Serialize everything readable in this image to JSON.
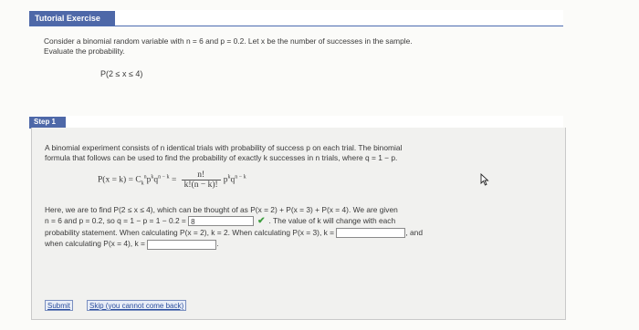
{
  "header": {
    "title": "Tutorial Exercise"
  },
  "problem": {
    "line1": "Consider a binomial random variable with n = 6 and p = 0.2. Let x be the number of successes in the sample.",
    "line2": "Evaluate the probability.",
    "expression": "P(2 ≤ x ≤ 4)"
  },
  "step": {
    "label": "Step 1",
    "intro_line1": "A binomial experiment consists of n identical trials with probability of success p on each trial. The binomial",
    "intro_line2": "formula that follows can be used to find the probability of exactly k successes in n trials, where q = 1 − p.",
    "formula_lhs": "P(x = k) = C",
    "formula_sub": "k",
    "formula_sup": "n",
    "formula_mid": "p",
    "formula_tail": "q",
    "formula_exp_k": "k",
    "formula_exp_nk": "n − k",
    "formula_eq": " = ",
    "frac_num": "n!",
    "frac_den": "k!(n − k)!",
    "body_line1": "Here, we are to find P(2 ≤ x ≤ 4), which can be thought of as P(x = 2) + P(x = 3) + P(x = 4). We are given",
    "body_line2_pre": "n = 6 and p = 0.2, so q = 1 − p = 1 − 0.2 =",
    "q_value": "8",
    "body_line2_post": ". The value of k will change with each",
    "body_line3_pre": "probability statement. When calculating P(x = 2), k = 2. When calculating P(x = 3), k =",
    "body_line3_post": ", and",
    "body_line4_pre": "when calculating P(x = 4), k =",
    "body_line4_post": ".",
    "k3_value": "",
    "k4_value": ""
  },
  "buttons": {
    "submit": "Submit",
    "skip": "Skip (you cannot come back)"
  }
}
